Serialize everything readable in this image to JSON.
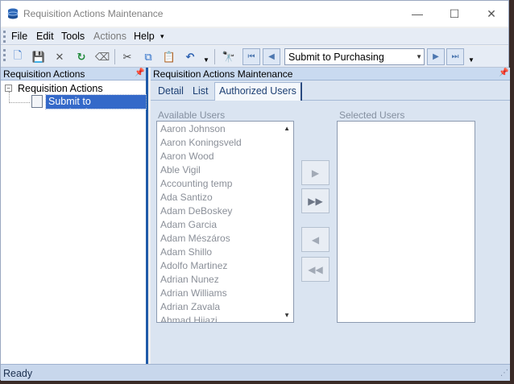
{
  "window": {
    "title": "Requisition Actions Maintenance",
    "minimize_glyph": "—",
    "maximize_glyph": "☐",
    "close_glyph": "✕"
  },
  "menu": {
    "file": "File",
    "edit": "Edit",
    "tools": "Tools",
    "actions": "Actions",
    "help": "Help",
    "overflow_glyph": "▾"
  },
  "toolbar": {
    "icons": [
      "new-icon",
      "save-icon",
      "delete-icon",
      "refresh-icon",
      "eraser-icon",
      "cut-icon",
      "copy-icon",
      "paste-icon",
      "undo-icon",
      "find-icon"
    ],
    "glyphs": {
      "new": "🗋",
      "save": "💾",
      "delete": "✕",
      "refresh": "↻",
      "eraser": "⌫",
      "cut": "✂",
      "copy": "⧉",
      "paste": "📋",
      "undo": "↶",
      "find": "🔭",
      "first": "⏮",
      "prev": "◀",
      "next": "▶",
      "last": "⏭",
      "dropdown": "▼"
    },
    "record_selector": "Submit to Purchasing"
  },
  "left_pane": {
    "header": "Requisition Actions",
    "pin_glyph": "📌",
    "tree": {
      "expander": "−",
      "root": "Requisition Actions",
      "children": [
        "Submit to Purchasing"
      ]
    }
  },
  "right_pane": {
    "header": "Requisition Actions Maintenance",
    "pin_glyph": "📌",
    "tabs": [
      {
        "label": "Detail",
        "active": false
      },
      {
        "label": "List",
        "active": false
      },
      {
        "label": "Authorized Users",
        "active": true
      }
    ],
    "available_label": "Available Users",
    "selected_label": "Selected Users",
    "available_users": [
      "Aaron Johnson",
      "Aaron Koningsveld",
      "Aaron Wood",
      "Able Vigil",
      "Accounting temp",
      "Ada Santizo",
      "Adam DeBoskey",
      "Adam Garcia",
      "Adam Mészáros",
      "Adam Shillo",
      "Adolfo Martinez",
      "Adrian Nunez",
      "Adrian Williams",
      "Adrian Zavala",
      "Ahmad Hijazi"
    ],
    "selected_users": [],
    "scroll_up": "▲",
    "scroll_down": "▼",
    "transfer_buttons": {
      "add": "▶",
      "add_all": "▶▶",
      "remove": "◀",
      "remove_all": "◀◀"
    }
  },
  "status": {
    "text": "Ready",
    "grip": "⋰"
  },
  "colors": {
    "selection": "#3469c9",
    "pane_header": "#c9daf0",
    "status_bar": "#c8d7ec"
  }
}
